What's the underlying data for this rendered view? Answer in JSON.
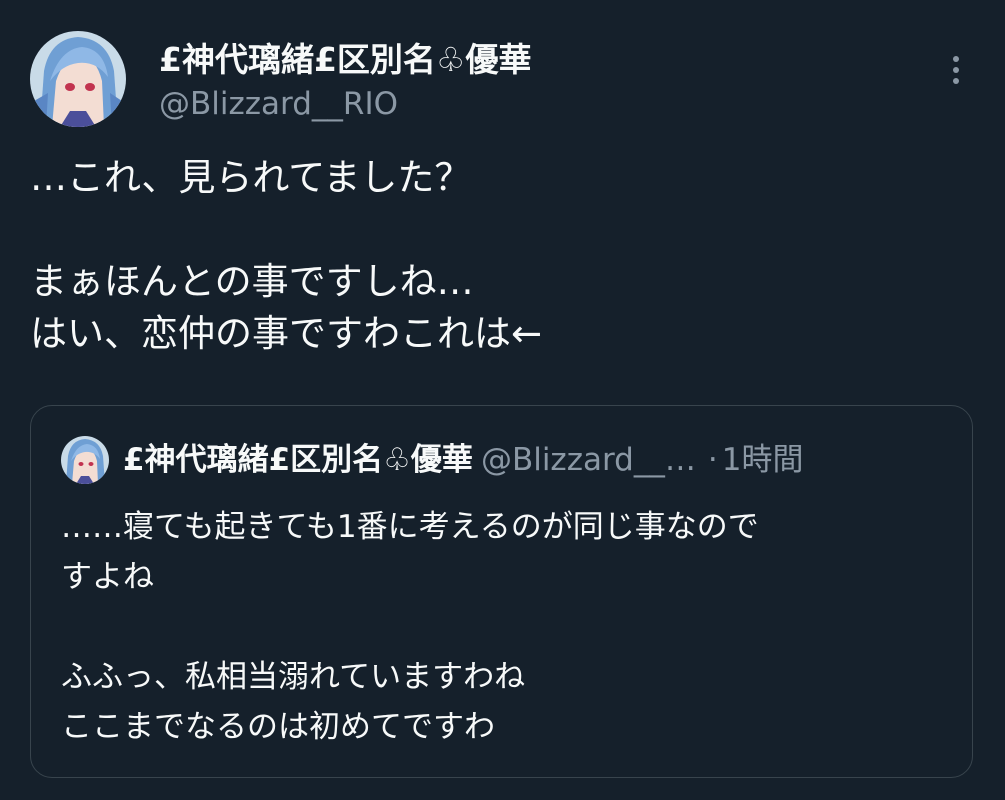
{
  "tweet": {
    "display_name": "£神代璃緒£区別名♧優華",
    "handle": "@Blizzard__RIO",
    "body_lines": [
      "…これ、見られてました？",
      "",
      "まぁほんとの事ですしね…",
      "はい、恋仲の事ですわこれは←"
    ]
  },
  "quote": {
    "display_name": "£神代璃緒£区別名♧優華",
    "handle": "@Blizzard__…",
    "separator": "·",
    "time": "1時間",
    "body_lines": [
      "……寝ても起きても1番に考えるのが同じ事なので",
      "すよね",
      "",
      "ふふっ、私相当溺れていますわね",
      "ここまでなるのは初めてですわ"
    ]
  },
  "icons": {
    "more": "more-vertical-icon",
    "avatar": "avatar-image"
  },
  "colors": {
    "background": "#15202b",
    "text_primary": "#f7f9f9",
    "text_secondary": "#8b98a5",
    "border": "#38444d"
  }
}
